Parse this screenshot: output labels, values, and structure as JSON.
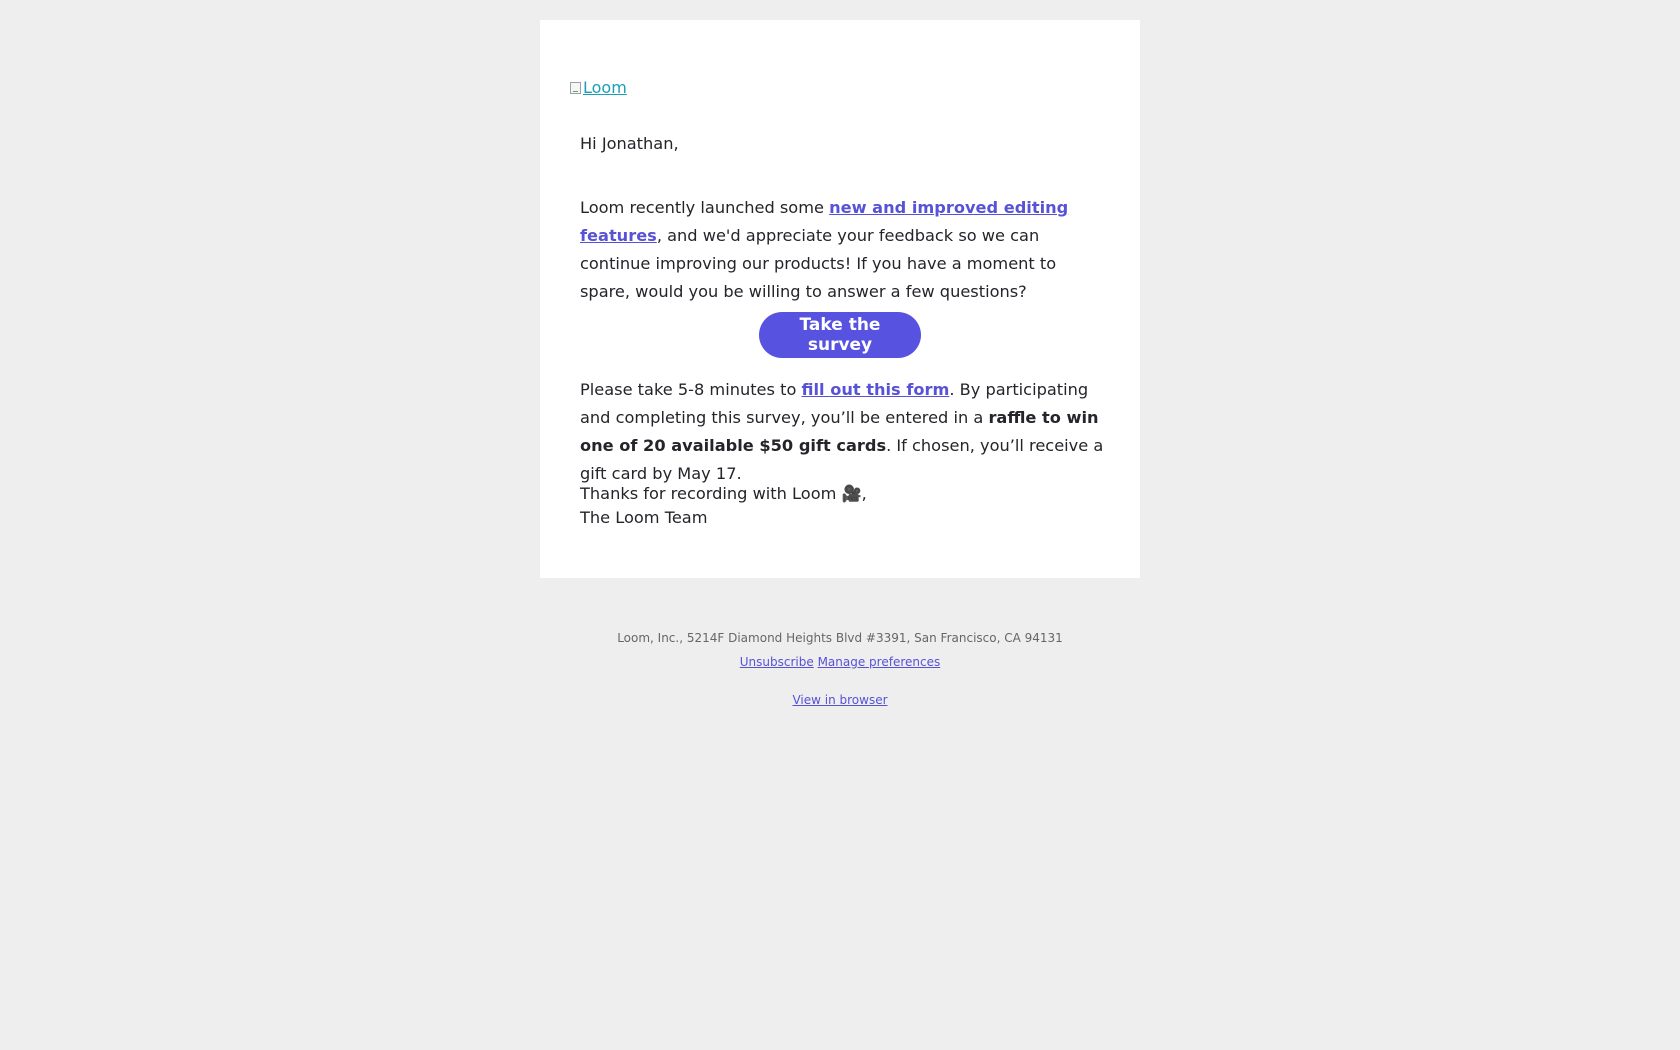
{
  "email": {
    "logo_alt": "Loom",
    "greeting": "Hi Jonathan,",
    "intro": {
      "before_link": "Loom recently launched some ",
      "link": "new and improved editing features",
      "after_link": ", and we'd appreciate your feedback so we can continue improving our products! If you have a moment to spare, would you be willing to answer a few questions?"
    },
    "cta_label": "Take the survey",
    "form": {
      "before_link": "Please take 5-8 minutes to ",
      "link": "fill out this form",
      "middle": ".  By participating and completing this survey, you’ll be entered in a ",
      "bold": "raffle to win one of 20 available $50 gift cards",
      "after": ". If chosen, you’ll receive a gift card by May 17."
    },
    "signoff_line1": "Thanks for recording with Loom 🎥,",
    "signoff_line2": "The Loom Team"
  },
  "footer": {
    "address": "Loom, Inc., 5214F Diamond Heights Blvd #3391, San Francisco, CA 94131",
    "unsubscribe": "Unsubscribe",
    "manage_preferences": "Manage preferences",
    "view_in_browser": "View in browser"
  },
  "colors": {
    "background": "#eeeeee",
    "card": "#ffffff",
    "accent": "#5752e0",
    "text": "#24242a"
  }
}
